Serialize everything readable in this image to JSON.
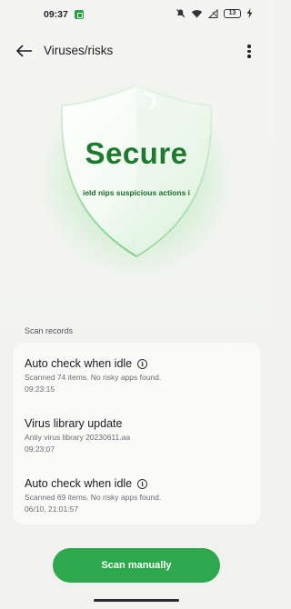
{
  "status_bar": {
    "time": "09:37",
    "battery": "13"
  },
  "app_bar": {
    "title": "Viruses/risks"
  },
  "hero": {
    "status": "Secure",
    "tagline": "ield nips suspicious actions i"
  },
  "records": {
    "section_label": "Scan records",
    "items": [
      {
        "title": "Auto check when idle",
        "has_info": true,
        "line1": "Scanned 74 items. No risky apps found.",
        "line2": "09:23:15"
      },
      {
        "title": "Virus library update",
        "has_info": false,
        "line1": "Antiy virus library 20230611.aa",
        "line2": "09:23:07"
      },
      {
        "title": "Auto check when idle",
        "has_info": true,
        "line1": "Scanned 69 items. No risky apps found.",
        "line2": "06/10, 21:01:57"
      }
    ]
  },
  "actions": {
    "scan_label": "Scan manually"
  },
  "colors": {
    "accent": "#2ea84c",
    "status_text": "#1d7a2f"
  }
}
